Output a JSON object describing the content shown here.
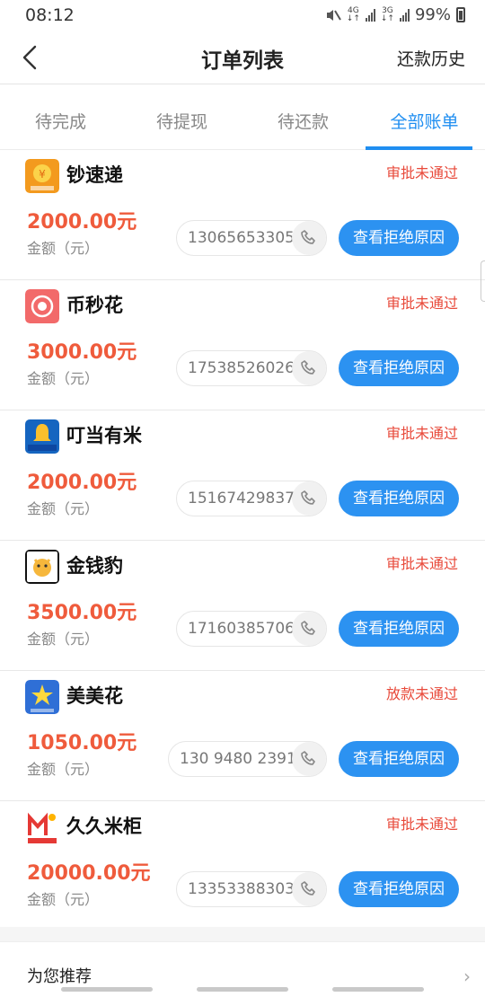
{
  "status_bar": {
    "time": "08:12",
    "network": "4G",
    "network2": "3G",
    "battery": "99%"
  },
  "nav": {
    "title": "订单列表",
    "action": "还款历史"
  },
  "tabs": [
    {
      "label": "待完成",
      "active": false
    },
    {
      "label": "待提现",
      "active": false
    },
    {
      "label": "待还款",
      "active": false
    },
    {
      "label": "全部账单",
      "active": true
    }
  ],
  "orders": [
    {
      "name": "钞速递",
      "status": "审批未通过",
      "amount": "2000.00元",
      "amount_label": "金额（元）",
      "phone": "13065653305",
      "button": "查看拒绝原因"
    },
    {
      "name": "币秒花",
      "status": "审批未通过",
      "amount": "3000.00元",
      "amount_label": "金额（元）",
      "phone": "17538526026",
      "button": "查看拒绝原因"
    },
    {
      "name": "叮当有米",
      "status": "审批未通过",
      "amount": "2000.00元",
      "amount_label": "金额（元）",
      "phone": "15167429837",
      "button": "查看拒绝原因"
    },
    {
      "name": "金钱豹",
      "status": "审批未通过",
      "amount": "3500.00元",
      "amount_label": "金额（元）",
      "phone": "17160385706",
      "button": "查看拒绝原因"
    },
    {
      "name": "美美花",
      "status": "放款未通过",
      "amount": "1050.00元",
      "amount_label": "金额（元）",
      "phone": "130 9480 2391",
      "button": "查看拒绝原因"
    },
    {
      "name": "久久米柜",
      "status": "审批未通过",
      "amount": "20000.00元",
      "amount_label": "金额（元）",
      "phone": "13353388303",
      "button": "查看拒绝原因"
    }
  ],
  "recommend": {
    "title": "为您推荐"
  },
  "colors": {
    "accent": "#2c92f1",
    "status_red": "#e8493a",
    "amount_red": "#ef5b3c"
  }
}
